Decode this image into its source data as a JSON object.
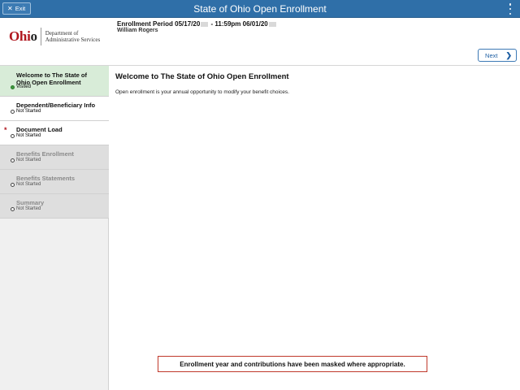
{
  "titlebar": {
    "title": "State of Ohio Open Enrollment",
    "exit_label": "Exit"
  },
  "header": {
    "logo_word_1": "Ohi",
    "logo_word_2": "o",
    "dept_line1": "Department of",
    "dept_line2": "Administrative Services",
    "period_a": "Enrollment Period 05/17/20",
    "period_b": " - 11:59pm 06/01/20",
    "user_name": "William Rogers",
    "next_label": "Next"
  },
  "sidebar": {
    "steps": [
      {
        "label": "Welcome to The State of Ohio Open Enrollment",
        "status": "Visited"
      },
      {
        "label": "Dependent/Beneficiary Info",
        "status": "Not Started"
      },
      {
        "label": "Document Load",
        "status": "Not Started",
        "required_mark": "*"
      },
      {
        "label": "Benefits Enrollment",
        "status": "Not Started"
      },
      {
        "label": "Benefits Statements",
        "status": "Not Started"
      },
      {
        "label": "Summary",
        "status": "Not Started"
      }
    ]
  },
  "main": {
    "heading": "Welcome to The State of Ohio Open Enrollment",
    "body": "Open enrollment is your annual opportunity to modify your benefit choices.",
    "notice": "Enrollment year and contributions have been masked where appropriate."
  },
  "colors": {
    "titlebar_bg": "#2f6fa8",
    "active_step_bg": "#d8ecd8",
    "visited_dot": "#3e9b3e",
    "ohio_red": "#b0161e",
    "notice_border": "#c0392b"
  },
  "icons": {
    "exit": "close-icon",
    "menu": "kebab-menu-icon",
    "next": "chevron-right-icon",
    "status": "status-dot-icon"
  }
}
